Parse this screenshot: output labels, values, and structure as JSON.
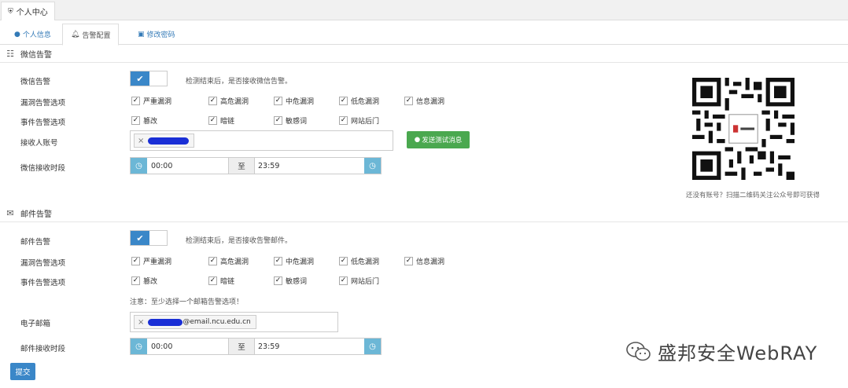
{
  "top_tab": {
    "label": "个人中心"
  },
  "sub_tabs": [
    {
      "label": "个人信息"
    },
    {
      "label": "告警配置"
    },
    {
      "label": "修改密码"
    }
  ],
  "wechat": {
    "section_title": "微信告警",
    "toggle_label": "微信告警",
    "toggle_hint": "检测结束后，是否接收微信告警。",
    "vuln_label": "漏洞告警选项",
    "vuln_options": [
      "严重漏洞",
      "高危漏洞",
      "中危漏洞",
      "低危漏洞",
      "信息漏洞"
    ],
    "event_label": "事件告警选项",
    "event_options": [
      "篡改",
      "暗链",
      "敏感词",
      "网站后门"
    ],
    "receiver_label": "接收人账号",
    "test_button": "发送测试消息",
    "time_label": "微信接收时段",
    "time_start": "00:00",
    "time_sep": "至",
    "time_end": "23:59"
  },
  "qr": {
    "caption": "还没有账号？扫描二维码关注公众号即可获得"
  },
  "mail": {
    "section_title": "邮件告警",
    "toggle_label": "邮件告警",
    "toggle_hint": "检测结束后，是否接收告警邮件。",
    "vuln_label": "漏洞告警选项",
    "vuln_options": [
      "严重漏洞",
      "高危漏洞",
      "中危漏洞",
      "低危漏洞",
      "信息漏洞"
    ],
    "event_label": "事件告警选项",
    "event_options": [
      "篡改",
      "暗链",
      "敏感词",
      "网站后门"
    ],
    "note": "注意：至少选择一个邮箱告警选项！",
    "email_label": "电子邮箱",
    "email_suffix": "@email.ncu.edu.cn",
    "time_label": "邮件接收时段",
    "time_start": "00:00",
    "time_sep": "至",
    "time_end": "23:59"
  },
  "submit_label": "提交",
  "watermark": "盛邦安全WebRAY",
  "colors": {
    "primary": "#3a87c8",
    "success": "#4aa84f",
    "clock": "#6cb7d6"
  }
}
